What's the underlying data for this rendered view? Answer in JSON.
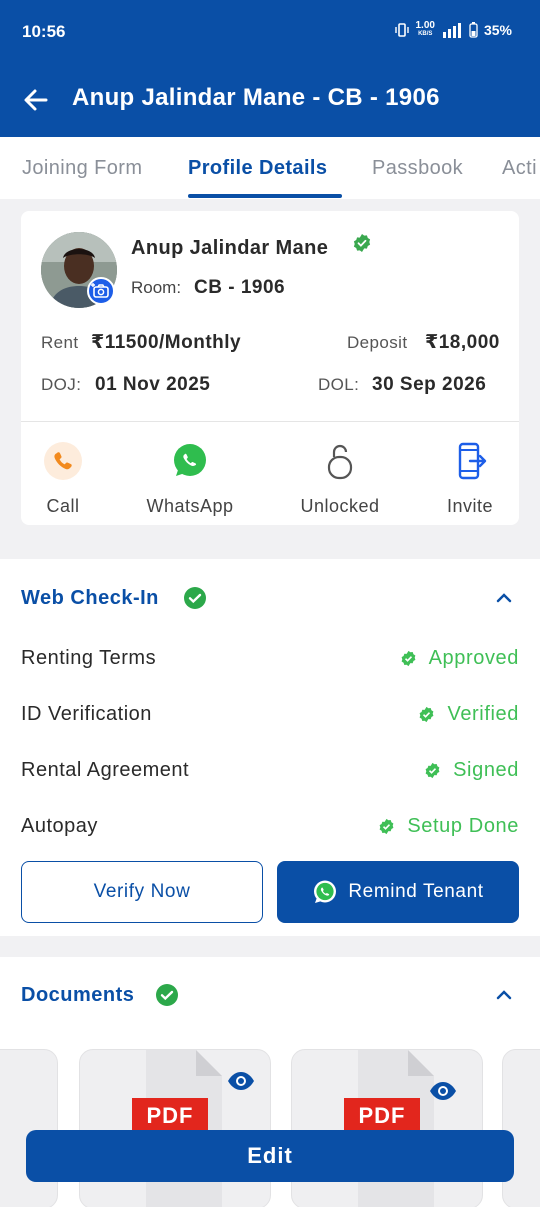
{
  "status_bar": {
    "time": "10:56",
    "net_speed_value": "1.00",
    "net_speed_unit": "KB/S",
    "battery": "35%"
  },
  "app_bar": {
    "title": "Anup Jalindar Mane - CB - 1906",
    "back_icon": "arrow-left-icon"
  },
  "tabs": [
    {
      "label": "Joining Form"
    },
    {
      "label": "Profile Details",
      "active": true
    },
    {
      "label": "Passbook"
    },
    {
      "label": "Acti"
    }
  ],
  "profile": {
    "name": "Anup Jalindar Mane",
    "room_label": "Room:",
    "room_value": "CB - 1906",
    "rent_label": "Rent",
    "rent_value": "₹11500/Monthly",
    "deposit_label": "Deposit",
    "deposit_value": "₹18,000",
    "doj_label": "DOJ:",
    "doj_value": "01 Nov 2025",
    "dol_label": "DOL:",
    "dol_value": "30 Sep 2026",
    "actions": [
      {
        "label": "Call",
        "icon": "phone-icon"
      },
      {
        "label": "WhatsApp",
        "icon": "whatsapp-icon"
      },
      {
        "label": "Unlocked",
        "icon": "unlocked-icon"
      },
      {
        "label": "Invite",
        "icon": "invite-icon"
      }
    ]
  },
  "web_checkin": {
    "title": "Web Check-In",
    "rows": [
      {
        "label": "Renting Terms",
        "status": "Approved"
      },
      {
        "label": "ID Verification",
        "status": "Verified"
      },
      {
        "label": "Rental Agreement",
        "status": "Signed"
      },
      {
        "label": "Autopay",
        "status": "Setup Done"
      }
    ],
    "verify_button": "Verify Now",
    "remind_button": "Remind Tenant"
  },
  "documents": {
    "title": "Documents",
    "pdf_label": "PDF"
  },
  "edit_button": "Edit",
  "colors": {
    "primary": "#0a4fa6",
    "success": "#3fbf56",
    "pdf": "#e2261d"
  }
}
